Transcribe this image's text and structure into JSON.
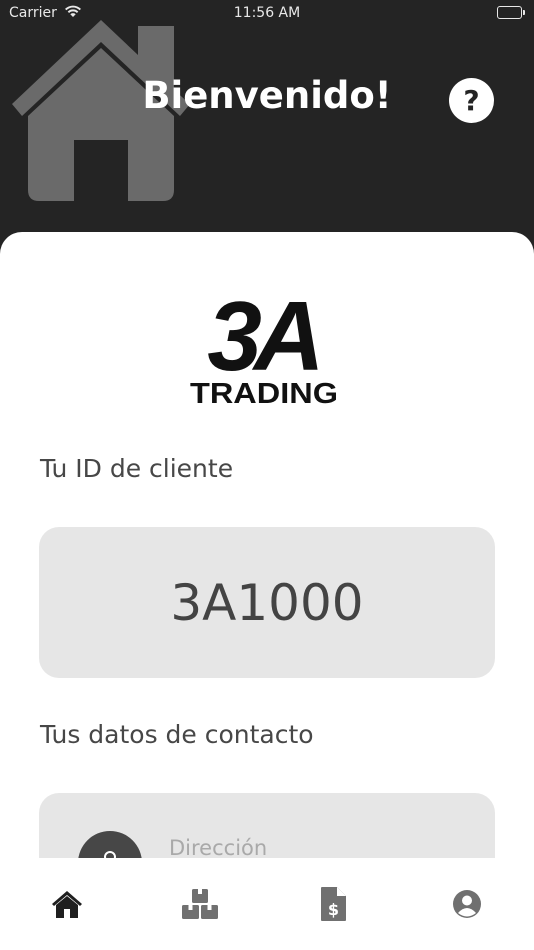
{
  "status_bar": {
    "carrier": "Carrier",
    "time": "11:56 AM",
    "battery_level": 1.0
  },
  "header": {
    "title": "Bienvenido!",
    "background_icon": "house-icon",
    "help_icon": "help-icon",
    "help_glyph": "?"
  },
  "logo": {
    "mark": "3A",
    "wordmark": "TRADING"
  },
  "client_id": {
    "label": "Tu ID de cliente",
    "value": "3A1000"
  },
  "contact": {
    "label": "Tus datos de contacto",
    "address_label": "Dirección",
    "address_icon": "location-pin-icon"
  },
  "tab_bar": {
    "items": [
      {
        "icon": "home-icon",
        "active": true
      },
      {
        "icon": "packages-icon",
        "active": false
      },
      {
        "icon": "invoice-icon",
        "active": false
      },
      {
        "icon": "profile-icon",
        "active": false
      }
    ]
  },
  "colors": {
    "header_background": "#242424",
    "card_background": "#ffffff",
    "field_background": "#e6e6e6",
    "text_dark": "#474747",
    "tab_active": "#1f1f1f",
    "tab_inactive": "#707070"
  }
}
